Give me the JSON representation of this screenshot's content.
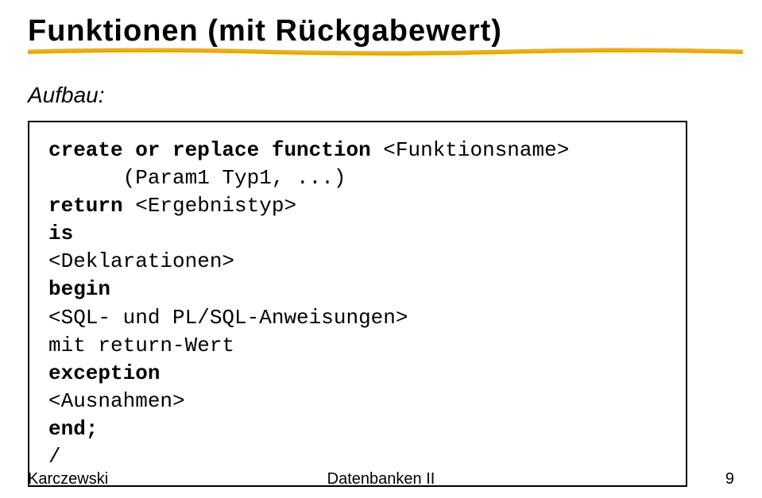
{
  "title": "Funktionen (mit Rückgabewert)",
  "subtitle": "Aufbau:",
  "code": {
    "line1_kw": "create or replace function ",
    "line1_rest": "<Funktionsname>",
    "line2": "      (Param1 Typ1, ...)",
    "line3_kw": "return ",
    "line3_rest": "<Ergebnistyp>",
    "line4_kw": "is",
    "line5": "<Deklarationen>",
    "line6_kw": "begin",
    "line7": "<SQL- und PL/SQL-Anweisungen>",
    "line8": "mit return-Wert",
    "line9_kw": "exception",
    "line10": "<Ausnahmen>",
    "line11_kw": "end;",
    "line12": "/"
  },
  "footer": {
    "left": "Karczewski",
    "center": "Datenbanken II",
    "right": "9"
  }
}
